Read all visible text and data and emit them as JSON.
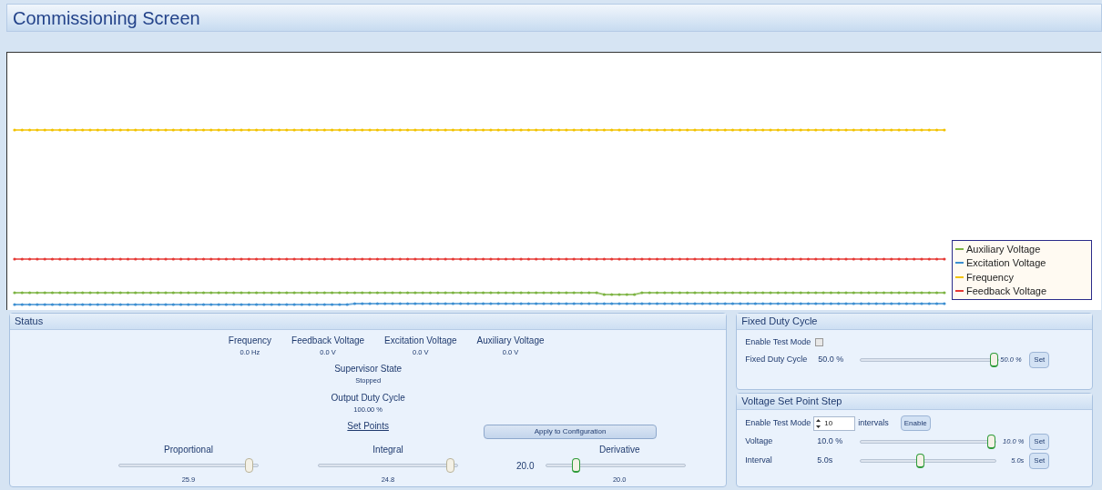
{
  "window": {
    "title": "Commissioning Screen"
  },
  "legend": [
    {
      "label": "Auxiliary Voltage",
      "color": "#7cb342"
    },
    {
      "label": "Excitation Voltage",
      "color": "#3d8fd1"
    },
    {
      "label": "Frequency",
      "color": "#f2c200"
    },
    {
      "label": "Feedback Voltage",
      "color": "#e53935"
    }
  ],
  "status": {
    "title": "Status",
    "readings": [
      {
        "label": "Frequency",
        "value": "0.0 Hz"
      },
      {
        "label": "Feedback Voltage",
        "value": "0.0 V"
      },
      {
        "label": "Excitation Voltage",
        "value": "0.0 V"
      },
      {
        "label": "Auxiliary Voltage",
        "value": "0.0 V"
      }
    ],
    "supervisor": {
      "label": "Supervisor State",
      "value": "Stopped"
    },
    "duty": {
      "label": "Output Duty Cycle",
      "value": "100.00 %"
    },
    "set_points_link": "Set Points",
    "apply_button": "Apply to Configuration",
    "sliders": [
      {
        "label": "Proportional",
        "level": 0.96,
        "reading": "25.9"
      },
      {
        "label": "Integral",
        "level": 0.97,
        "reading": "24.8"
      },
      {
        "label": "Derivative",
        "level": 0.2,
        "reading": "20.0",
        "value": "20.0"
      }
    ]
  },
  "fixed_duty": {
    "title": "Fixed Duty Cycle",
    "enable_label": "Enable Test Mode",
    "checked": false,
    "slider_label": "Fixed Duty Cycle",
    "slider_value": "50.0 %",
    "level": 0.99,
    "reading": "50.0 %",
    "button": "Set"
  },
  "step": {
    "title": "Voltage Set Point Step",
    "enable_label": "Enable Test Mode",
    "intervals_value": "10",
    "intervals_label": "intervals",
    "enable_button": "Enable",
    "rows": [
      {
        "label": "Voltage",
        "value": "10.0 %",
        "level": 0.99,
        "reading": "10.0 %",
        "button": "Set"
      },
      {
        "label": "Interval",
        "value": "5.0s",
        "level": 0.44,
        "reading": "5.0s",
        "button": "Set"
      }
    ]
  }
}
